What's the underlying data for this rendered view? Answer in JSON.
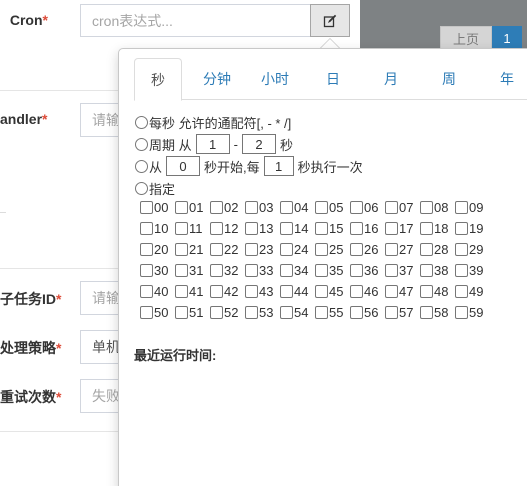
{
  "form": {
    "cron_label": "Cron",
    "required_mark": "*",
    "cron_placeholder": "cron表达式...",
    "handler_label": "andler",
    "handler_placeholder": "请输",
    "childjob_label": "子任务ID",
    "childjob_placeholder": "请输",
    "strategy_label": "处理策略",
    "strategy_value": "单机",
    "retry_label": "重试次数",
    "retry_placeholder": "失败"
  },
  "pager": {
    "prev": "上页",
    "page": "1"
  },
  "cron_popover": {
    "tabs": [
      "秒",
      "分钟",
      "小时",
      "日",
      "月",
      "周",
      "年"
    ],
    "active_tab": "秒",
    "options": {
      "every": "每秒 允许的通配符[, - * /]",
      "cycle_prefix": "周期 从",
      "cycle_from": "1",
      "cycle_sep": "-",
      "cycle_to": "2",
      "cycle_unit": "秒",
      "from_prefix": "从",
      "from_start": "0",
      "from_mid": "秒开始,每",
      "from_step": "1",
      "from_suffix": "秒执行一次",
      "specify": "指定"
    },
    "seconds": [
      [
        "00",
        "01",
        "02",
        "03",
        "04",
        "05",
        "06",
        "07",
        "08",
        "09"
      ],
      [
        "10",
        "11",
        "12",
        "13",
        "14",
        "15",
        "16",
        "17",
        "18",
        "19"
      ],
      [
        "20",
        "21",
        "22",
        "23",
        "24",
        "25",
        "26",
        "27",
        "28",
        "29"
      ],
      [
        "30",
        "31",
        "32",
        "33",
        "34",
        "35",
        "36",
        "37",
        "38",
        "39"
      ],
      [
        "40",
        "41",
        "42",
        "43",
        "44",
        "45",
        "46",
        "47",
        "48",
        "49"
      ],
      [
        "50",
        "51",
        "52",
        "53",
        "54",
        "55",
        "56",
        "57",
        "58",
        "59"
      ]
    ],
    "last_run_label": "最近运行时间:"
  },
  "icons": {
    "edit": "edit-icon"
  },
  "colors": {
    "tab_link": "#2c7bb6",
    "required": "#dd4b39",
    "pager_active": "#2e7db7"
  }
}
